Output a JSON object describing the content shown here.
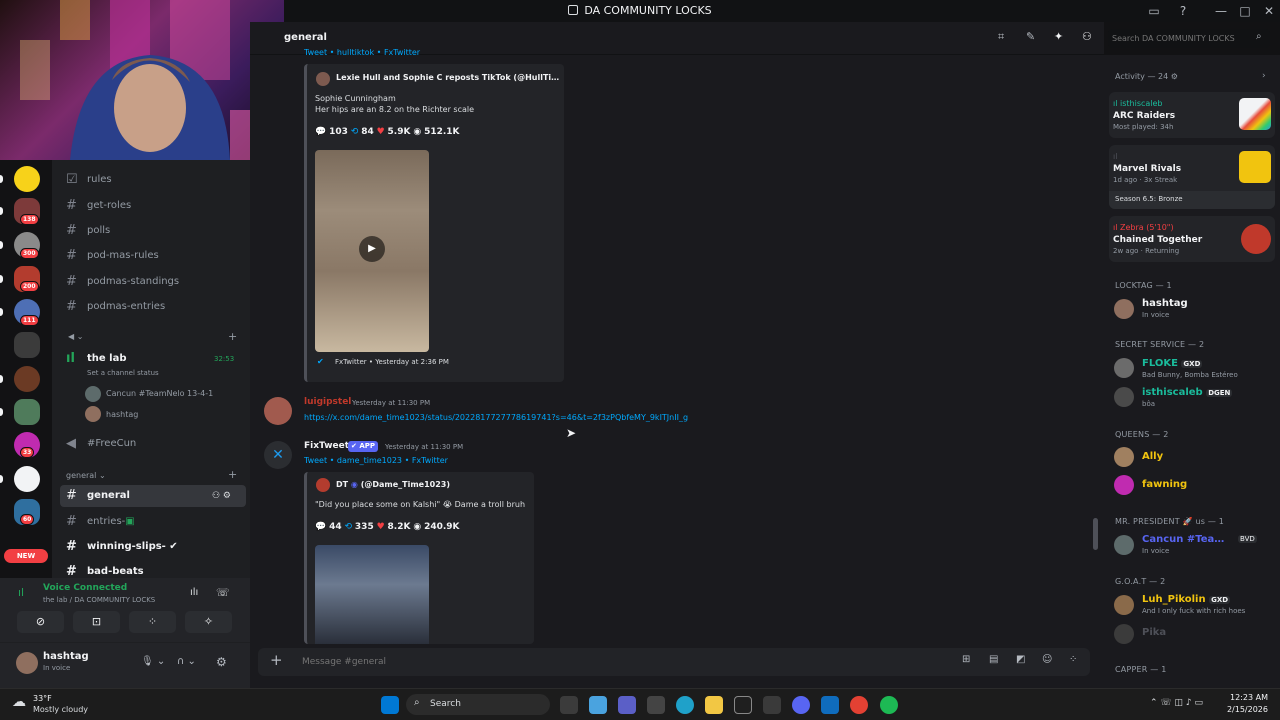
{
  "window": {
    "title": "DA COMMUNITY LOCKS"
  },
  "header": {
    "channel": "general",
    "search_placeholder": "Search DA COMMUNITY LOCKS"
  },
  "rail": {
    "badges": [
      "138",
      "300",
      "200",
      "111",
      "33",
      "60"
    ],
    "new_label": "NEW"
  },
  "channels": {
    "items": [
      "rules",
      "get-roles",
      "polls",
      "pod-mas-rules",
      "podmas-standings",
      "podmas-entries"
    ],
    "voice": {
      "name": "the lab",
      "timer": "32:53",
      "status": "Set a channel status",
      "users": [
        "Cancun #TeamNelo 13-4-1",
        "hashtag"
      ]
    },
    "freecun": "#FreeCun",
    "category": "general",
    "general_items": [
      "general",
      "entries-",
      "winning-slips-",
      "bad-beats"
    ]
  },
  "user_panel": {
    "voice_connected": "Voice Connected",
    "voice_path": "the lab / DA COMMUNITY LOCKS",
    "username": "hashtag",
    "status": "In voice"
  },
  "messages": {
    "top_fragment": "Tweet • hulltiktok • FxTwitter",
    "embed1": {
      "author": "Lexie Hull and Sophie C reposts TikTok (@HullTiktok)",
      "line1": "Sophie Cunningham",
      "line2": "Her hips are an 8.2 on the Richter scale",
      "replies": "103",
      "retweets": "84",
      "likes": "5.9K",
      "views": "512.1K",
      "footer": "FxTwitter • Yesterday at 2:36 PM"
    },
    "msg2": {
      "author": "luigipstel",
      "time": "Yesterday at 11:30 PM",
      "link": "https://x.com/dame_time1023/status/2022817727778619741?s=46&t=2f3zPQbfeMY_9kITJnII_g"
    },
    "msg3": {
      "author": "FixTweet",
      "app_tag": "APP",
      "time": "Yesterday at 11:30 PM",
      "sub": "Tweet • dame_time1023 • FxTwitter",
      "embed_author": "DT",
      "embed_handle": "(@Dame_Time1023)",
      "embed_text": "\"Did you place some on Kalshi\" 😭 Dame a troll bruh",
      "replies": "44",
      "retweets": "335",
      "likes": "8.2K",
      "views": "240.9K"
    }
  },
  "composer": {
    "placeholder": "Message #general"
  },
  "members": {
    "activity_header": "Activity — 24",
    "activities": [
      {
        "user": "isthiscaleb",
        "game": "ARC Raiders",
        "sub": "Most played: 34h"
      },
      {
        "user": "",
        "game": "Marvel Rivals",
        "sub": "1d ago  ·  3x Streak",
        "extra": "Season 6.5: Bronze"
      },
      {
        "user": "Zebra (5'10\")",
        "game": "Chained Together",
        "sub": "2w ago  ·  Returning"
      }
    ],
    "groups": [
      {
        "title": "LOCKTAG — 1",
        "members": [
          {
            "name": "hashtag",
            "sub": "In voice",
            "tag": "",
            "color": "#f2f3f5"
          }
        ]
      },
      {
        "title": "SECRET SERVICE — 2",
        "members": [
          {
            "name": "FLOKE",
            "sub": "Bad Bunny, Bomba Estéreo",
            "tag": "GXD",
            "color": "#1abc9c"
          },
          {
            "name": "isthiscaleb",
            "sub": "bôa",
            "tag": "DGEN",
            "color": "#1abc9c"
          }
        ]
      },
      {
        "title": "QUEENS — 2",
        "members": [
          {
            "name": "Ally",
            "sub": "",
            "tag": "",
            "color": "#f1c40f"
          },
          {
            "name": "fawning",
            "sub": "",
            "tag": "",
            "color": "#f1c40f"
          }
        ]
      },
      {
        "title": "MR. PRESIDENT 🚀 us — 1",
        "members": [
          {
            "name": "Cancun #TeamNelo",
            "sub": "In voice",
            "tag": "BVD",
            "color": "#5865f2"
          }
        ]
      },
      {
        "title": "G.O.A.T — 2",
        "members": [
          {
            "name": "Luh_Pikolin",
            "sub": "And I only fuck with rich hoes",
            "tag": "GXD",
            "color": "#f1c40f"
          },
          {
            "name": "Pika",
            "sub": "",
            "tag": "",
            "color": "#4e5058"
          }
        ]
      },
      {
        "title": "CAPPER — 1",
        "members": []
      }
    ]
  },
  "taskbar": {
    "weather_temp": "33°F",
    "weather_desc": "Mostly cloudy",
    "search": "Search",
    "time": "12:23 AM",
    "date": "2/15/2026"
  }
}
